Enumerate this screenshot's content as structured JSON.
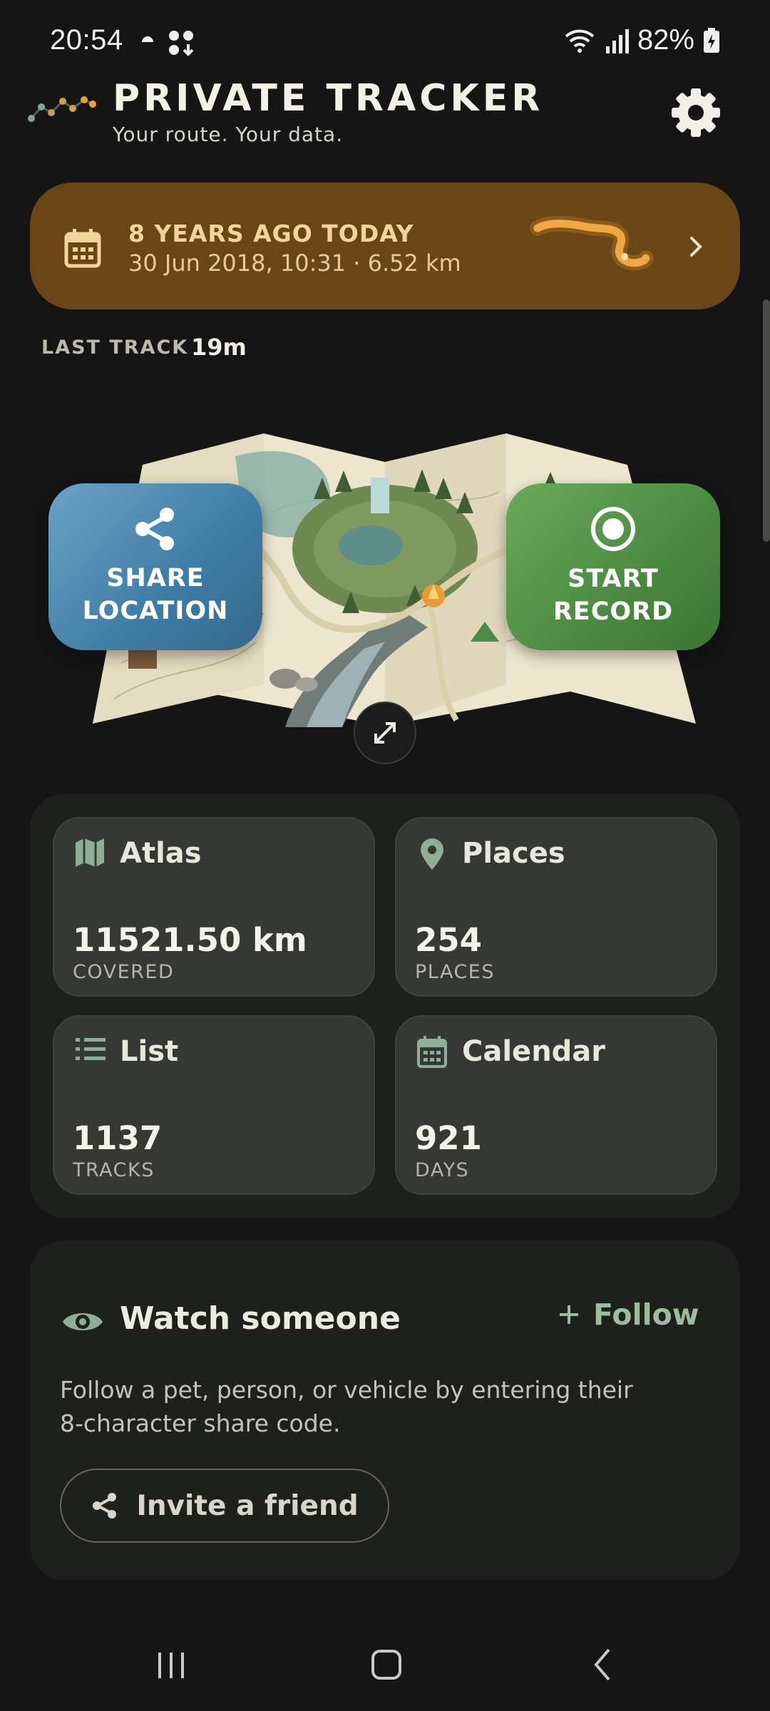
{
  "status_bar": {
    "time": "20:54",
    "battery": "82%",
    "icons": [
      "weather-icon",
      "notification-icon",
      "wifi-icon",
      "signal-icon",
      "battery-icon"
    ]
  },
  "header": {
    "title": "PRIVATE TRACKER",
    "subtitle": "Your route. Your data.",
    "icons": [
      "logo-icon",
      "gear-icon"
    ]
  },
  "memory": {
    "title": "8 YEARS AGO TODAY",
    "details": "30 Jun 2018, 10:31 · 6.52 km",
    "icons": [
      "calendar-icon",
      "route-thumbnail",
      "chevron-right-icon"
    ]
  },
  "last_track": {
    "label": "LAST TRACK",
    "value": "19m"
  },
  "actions": {
    "share": {
      "line1": "SHARE",
      "line2": "LOCATION",
      "icon": "share-icon"
    },
    "record": {
      "line1": "START",
      "line2": "RECORD",
      "icon": "record-icon"
    },
    "expand_icon": "expand-icon"
  },
  "stats": [
    {
      "name": "Atlas",
      "value": "11521.50 km",
      "unit": "COVERED",
      "icon": "map-icon"
    },
    {
      "name": "Places",
      "value": "254",
      "unit": "PLACES",
      "icon": "pin-icon"
    },
    {
      "name": "List",
      "value": "1137",
      "unit": "TRACKS",
      "icon": "list-icon"
    },
    {
      "name": "Calendar",
      "value": "921",
      "unit": "DAYS",
      "icon": "calendar-icon"
    }
  ],
  "watch": {
    "title": "Watch someone",
    "follow_label": "Follow",
    "description": "Follow a pet, person, or vehicle by entering their 8-character share code.",
    "invite_label": "Invite a friend"
  },
  "colors": {
    "background": "#141514",
    "memory_banner": "#6A4516",
    "share_button": "#4A86AE",
    "record_button": "#4E8D43",
    "tile": "#353835",
    "accent_green": "#9DBC9F"
  }
}
